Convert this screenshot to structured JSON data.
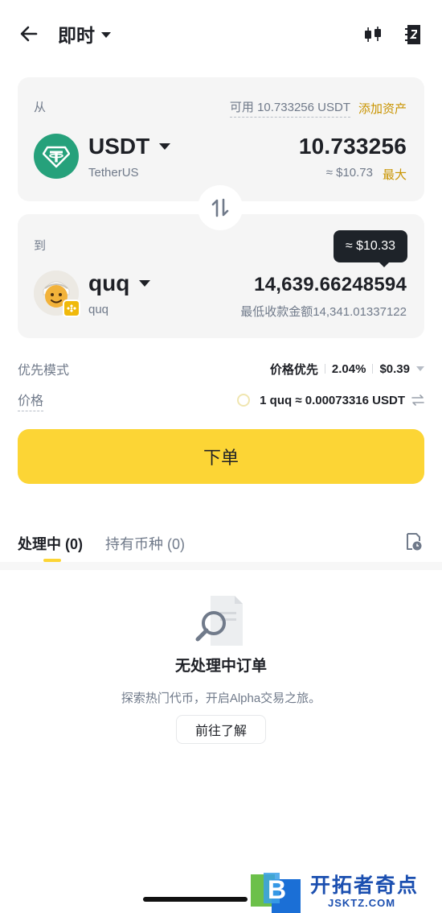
{
  "header": {
    "title": "即时",
    "back_icon": "arrow-left-icon",
    "chart_icon": "candlestick-chart-icon",
    "order_icon": "order-book-icon"
  },
  "from": {
    "label": "从",
    "available": "可用 10.733256 USDT",
    "add_asset": "添加资产",
    "token": "USDT",
    "token_sub": "TetherUS",
    "amount": "10.733256",
    "amount_usd": "≈ $10.73",
    "max": "最大"
  },
  "to": {
    "label": "到",
    "tooltip": "≈ $10.33",
    "token": "quq",
    "token_sub": "quq",
    "amount": "14,639.66248594",
    "min_receive": "最低收款金额14,341.01337122"
  },
  "priority": {
    "label": "优先模式",
    "mode": "价格优先",
    "slippage": "2.04%",
    "fee": "$0.39"
  },
  "price": {
    "label": "价格",
    "rate": "1 quq ≈ 0.00073316 USDT"
  },
  "submit": {
    "label": "下单"
  },
  "tabs": [
    {
      "label": "处理中 (0)",
      "active": true
    },
    {
      "label": "持有币种 (0)",
      "active": false
    }
  ],
  "empty": {
    "title": "无处理中订单",
    "desc": "探索热门代币，开启Alpha交易之旅。",
    "button": "前往了解"
  },
  "watermark": {
    "text": "开拓者奇点",
    "url": "JSKTZ.COM",
    "logo_letter": "B"
  },
  "colors": {
    "accent": "#fcd535",
    "link": "#c99400",
    "usdt": "#26a17b",
    "text": "#1e2026",
    "muted": "#707a8a"
  }
}
